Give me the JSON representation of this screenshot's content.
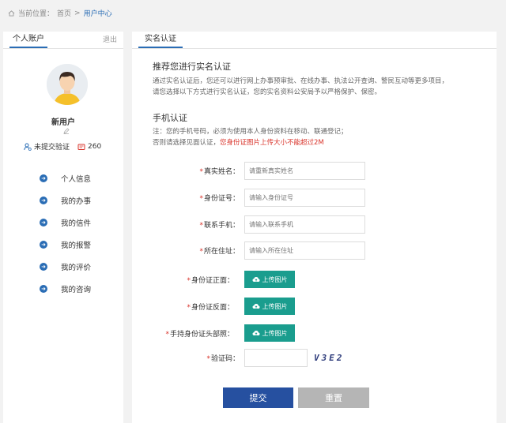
{
  "breadcrumb": {
    "prefix": "当前位置：",
    "home": "首页",
    "separator": ">",
    "current": "用户中心"
  },
  "left": {
    "tab": "个人账户",
    "logout": "退出",
    "username": "新用户",
    "verify_status": "未提交验证",
    "points": "260",
    "menu": [
      {
        "label": "个人信息"
      },
      {
        "label": "我的办事"
      },
      {
        "label": "我的信件"
      },
      {
        "label": "我的报警"
      },
      {
        "label": "我的评价"
      },
      {
        "label": "我的咨询"
      }
    ]
  },
  "right": {
    "tab": "实名认证",
    "title": "推荐您进行实名认证",
    "desc_line1": "通过实名认证后，您还可以进行网上办事预审批、在线办事、执法公开查询、警民互动等更多项目，",
    "desc_line2": "请您选择以下方式进行实名认证，您的实名资料公安局予以严格保护、保密。",
    "phone_title": "手机认证",
    "note_line1": "注：您的手机号码，必须为使用本人身份资料在移动、联通登记；",
    "note_line2_prefix": "否则请选择见面认证，",
    "note_line2_warn": "您身份证图片上传大小不能超过2M",
    "form": {
      "name_label": "真实姓名：",
      "name_placeholder": "请重新真实姓名",
      "id_label": "身份证号：",
      "id_placeholder": "请输入身份证号",
      "phone_label": "联系手机：",
      "phone_placeholder": "请输入联系手机",
      "address_label": "所在住址：",
      "address_placeholder": "请输入所在住址",
      "id_front_label": "身份证正面：",
      "id_back_label": "身份证反面：",
      "hand_id_label": "手持身份证头部照：",
      "upload_label": "上传图片",
      "captcha_label": "验证码：",
      "captcha_text": "V3E2"
    },
    "submit": "提交",
    "reset": "重置"
  },
  "colors": {
    "accent": "#2a6db5",
    "upload": "#1a9d8e",
    "submit": "#2650a0",
    "warn": "#d9342b"
  }
}
